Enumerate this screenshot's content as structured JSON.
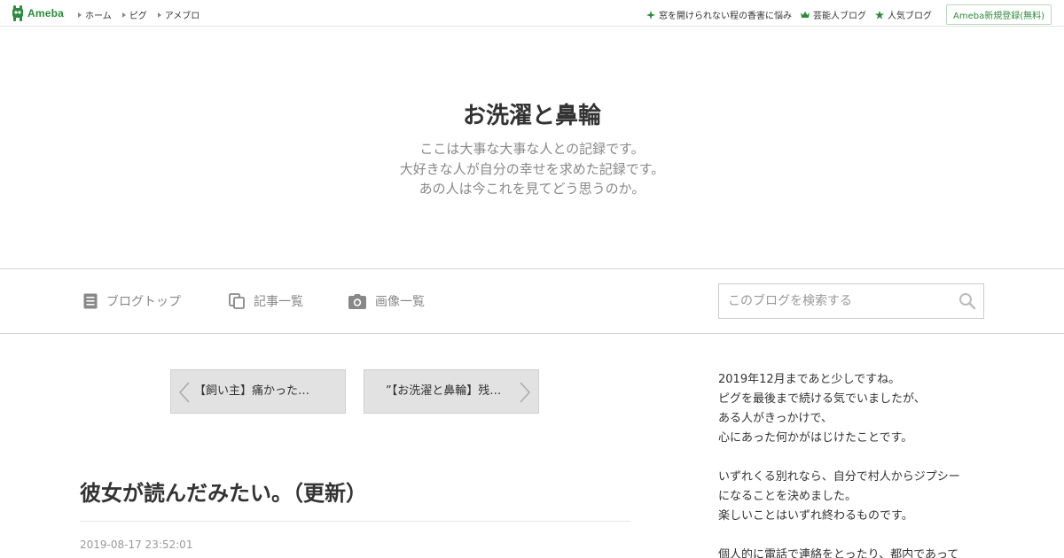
{
  "topbar": {
    "logo_text": "Ameba",
    "nav": [
      "ホーム",
      "ピグ",
      "アメブロ"
    ],
    "links": [
      {
        "label": "窓を開けられない程の香害に悩み",
        "icon": "sparkle-icon"
      },
      {
        "label": "芸能人ブログ",
        "icon": "crown-icon"
      },
      {
        "label": "人気ブログ",
        "icon": "star-icon"
      }
    ],
    "register_label": "Ameba新規登録(無料)"
  },
  "header": {
    "title": "お洗濯と鼻輪",
    "description": [
      "ここは大事な大事な人との記録です。",
      "大好きな人が自分の幸せを求めた記録です。",
      "あの人は今これを見てどう思うのか。"
    ]
  },
  "navbar": {
    "items": [
      {
        "label": "ブログトップ",
        "icon": "document-icon"
      },
      {
        "label": "記事一覧",
        "icon": "copy-icon"
      },
      {
        "label": "画像一覧",
        "icon": "camera-icon"
      }
    ],
    "search_placeholder": "このブログを検索する"
  },
  "pager": {
    "prev_label": "【飼い主】痛かった…",
    "next_label": "”【お洗濯と鼻輪】残…"
  },
  "article": {
    "title": "彼女が読んだみたい。（更新）",
    "date": "2019-08-17 23:52:01"
  },
  "sidebar": {
    "lines": [
      "2019年12月まであと少しですね。",
      "ピグを最後まで続ける気でいましたが、",
      "ある人がきっかけで、",
      "心にあった何かがはじけたことです。",
      "",
      "いずれくる別れなら、自分で村人からジプシー",
      "になることを決めました。",
      "楽しいことはいずれ終わるものです。",
      "",
      "個人的に電話で連絡をとったり、都内であって"
    ]
  },
  "colors": {
    "brand_green": "#2d8c3c",
    "muted_text": "#888888",
    "border": "#d5d5d5",
    "pager_bg": "#e2e2e2"
  }
}
